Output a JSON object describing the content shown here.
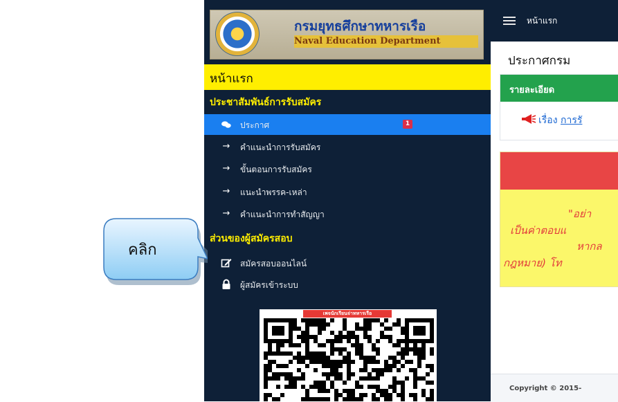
{
  "header": {
    "logo_th": "กรมยุทธศึกษาทหารเรือ",
    "logo_en": "Naval Education Department",
    "menu_home": "หน้าแรก"
  },
  "sidebar": {
    "home": "หน้าแรก",
    "section1": "ประชาสัมพันธ์การรับสมัคร",
    "items1": [
      {
        "label": "ประกาศ",
        "icon": "chat-icon",
        "badge": "1"
      },
      {
        "label": "คำแนะนำการรับสมัคร",
        "icon": "arrow-right-icon"
      },
      {
        "label": "ขั้นตอนการรับสมัคร",
        "icon": "arrow-right-icon"
      },
      {
        "label": "แนะนำพรรค-เหล่า",
        "icon": "arrow-right-icon"
      },
      {
        "label": "คำแนะนำการทำสัญญา",
        "icon": "arrow-right-icon"
      }
    ],
    "section2": "ส่วนของผู้สมัครสอบ",
    "items2": [
      {
        "label": "สมัครสอบออนไลน์",
        "icon": "edit-icon"
      },
      {
        "label": "ผู้สมัครเข้าระบบ",
        "icon": "lock-icon"
      }
    ],
    "qr_label": "เพจนักเรียนจ่าทหารเรือ"
  },
  "main": {
    "title": "ประกาศกรม",
    "card_title": "รายละเอียด",
    "notice_prefix": "เรื่อง",
    "notice_link": "การรั",
    "alert_lines": [
      "\"อย่า",
      "เป็นค่าตอบแ",
      "หากล",
      "กฎหมาย) โท"
    ]
  },
  "footer": {
    "copyright": "Copyright © 2015-"
  },
  "callout": {
    "text": "คลิก"
  },
  "colors": {
    "sidebar_bg": "#0e2037",
    "home_bg": "#ffee00",
    "section_text": "#ffee00",
    "active_bg": "#1a7ff0",
    "card_head": "#23a24d",
    "alert_head": "#e84545",
    "alert_body": "#fbf76a"
  }
}
